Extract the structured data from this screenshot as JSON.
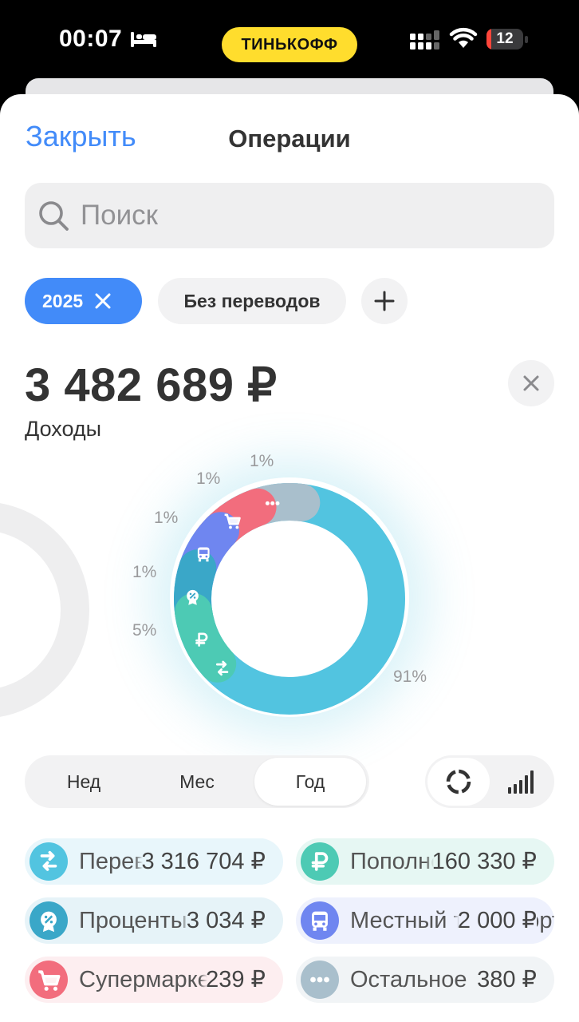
{
  "status_bar": {
    "time": "00:07",
    "brand": "ТИНЬКОФФ",
    "battery": "12",
    "battery_percent": 12,
    "battery_color": "#ff453a"
  },
  "header": {
    "close_label": "Закрыть",
    "title": "Операции"
  },
  "search": {
    "placeholder": "Поиск",
    "value": ""
  },
  "filters": {
    "year_chip": "2025",
    "transfers_chip": "Без переводов"
  },
  "summary": {
    "amount": "3 482 689 ₽",
    "label": "Доходы"
  },
  "period_tabs": [
    {
      "label": "Нед",
      "active": false
    },
    {
      "label": "Мес",
      "active": false
    },
    {
      "label": "Год",
      "active": true
    }
  ],
  "view_toggle": {
    "active": "donut-chart-icon",
    "other": "bar-chart-icon"
  },
  "categories": [
    {
      "name": "Переводы",
      "amount": "3 316 704 ₽",
      "icon": "arrows-exchange-icon",
      "color": "#52c4e0",
      "tint": "#e8f6fb"
    },
    {
      "name": "Пополнения",
      "amount": "160 330 ₽",
      "icon": "ruble-icon",
      "color": "#4dcab4",
      "tint": "#e6f7f3"
    },
    {
      "name": "Проценты",
      "amount": "3 034 ₽",
      "icon": "percent-badge-icon",
      "color": "#3aa7c8",
      "tint": "#e6f3f8"
    },
    {
      "name": "Местный транспорт",
      "amount": "2 000 ₽",
      "icon": "bus-icon",
      "color": "#6f86f0",
      "tint": "#eef1fd"
    },
    {
      "name": "Супермаркеты",
      "amount": "239 ₽",
      "icon": "cart-icon",
      "color": "#f26d7d",
      "tint": "#fdeef0"
    },
    {
      "name": "Остальное",
      "amount": "380 ₽",
      "icon": "more-dots-icon",
      "color": "#a9bfcc",
      "tint": "#f1f4f6"
    }
  ],
  "chart_data": {
    "type": "pie",
    "labels": [
      "Переводы",
      "Пополнения",
      "Проценты",
      "Местный транспорт",
      "Супермаркеты",
      "Остальное"
    ],
    "values": [
      3316704,
      160330,
      3034,
      2000,
      239,
      380
    ],
    "percent_labels": [
      "91%",
      "5%",
      "1%",
      "1%",
      "1%",
      "1%"
    ],
    "colors": [
      "#52c4e0",
      "#4dcab4",
      "#3aa7c8",
      "#6f86f0",
      "#f26d7d",
      "#a9bfcc"
    ],
    "donut": true
  }
}
